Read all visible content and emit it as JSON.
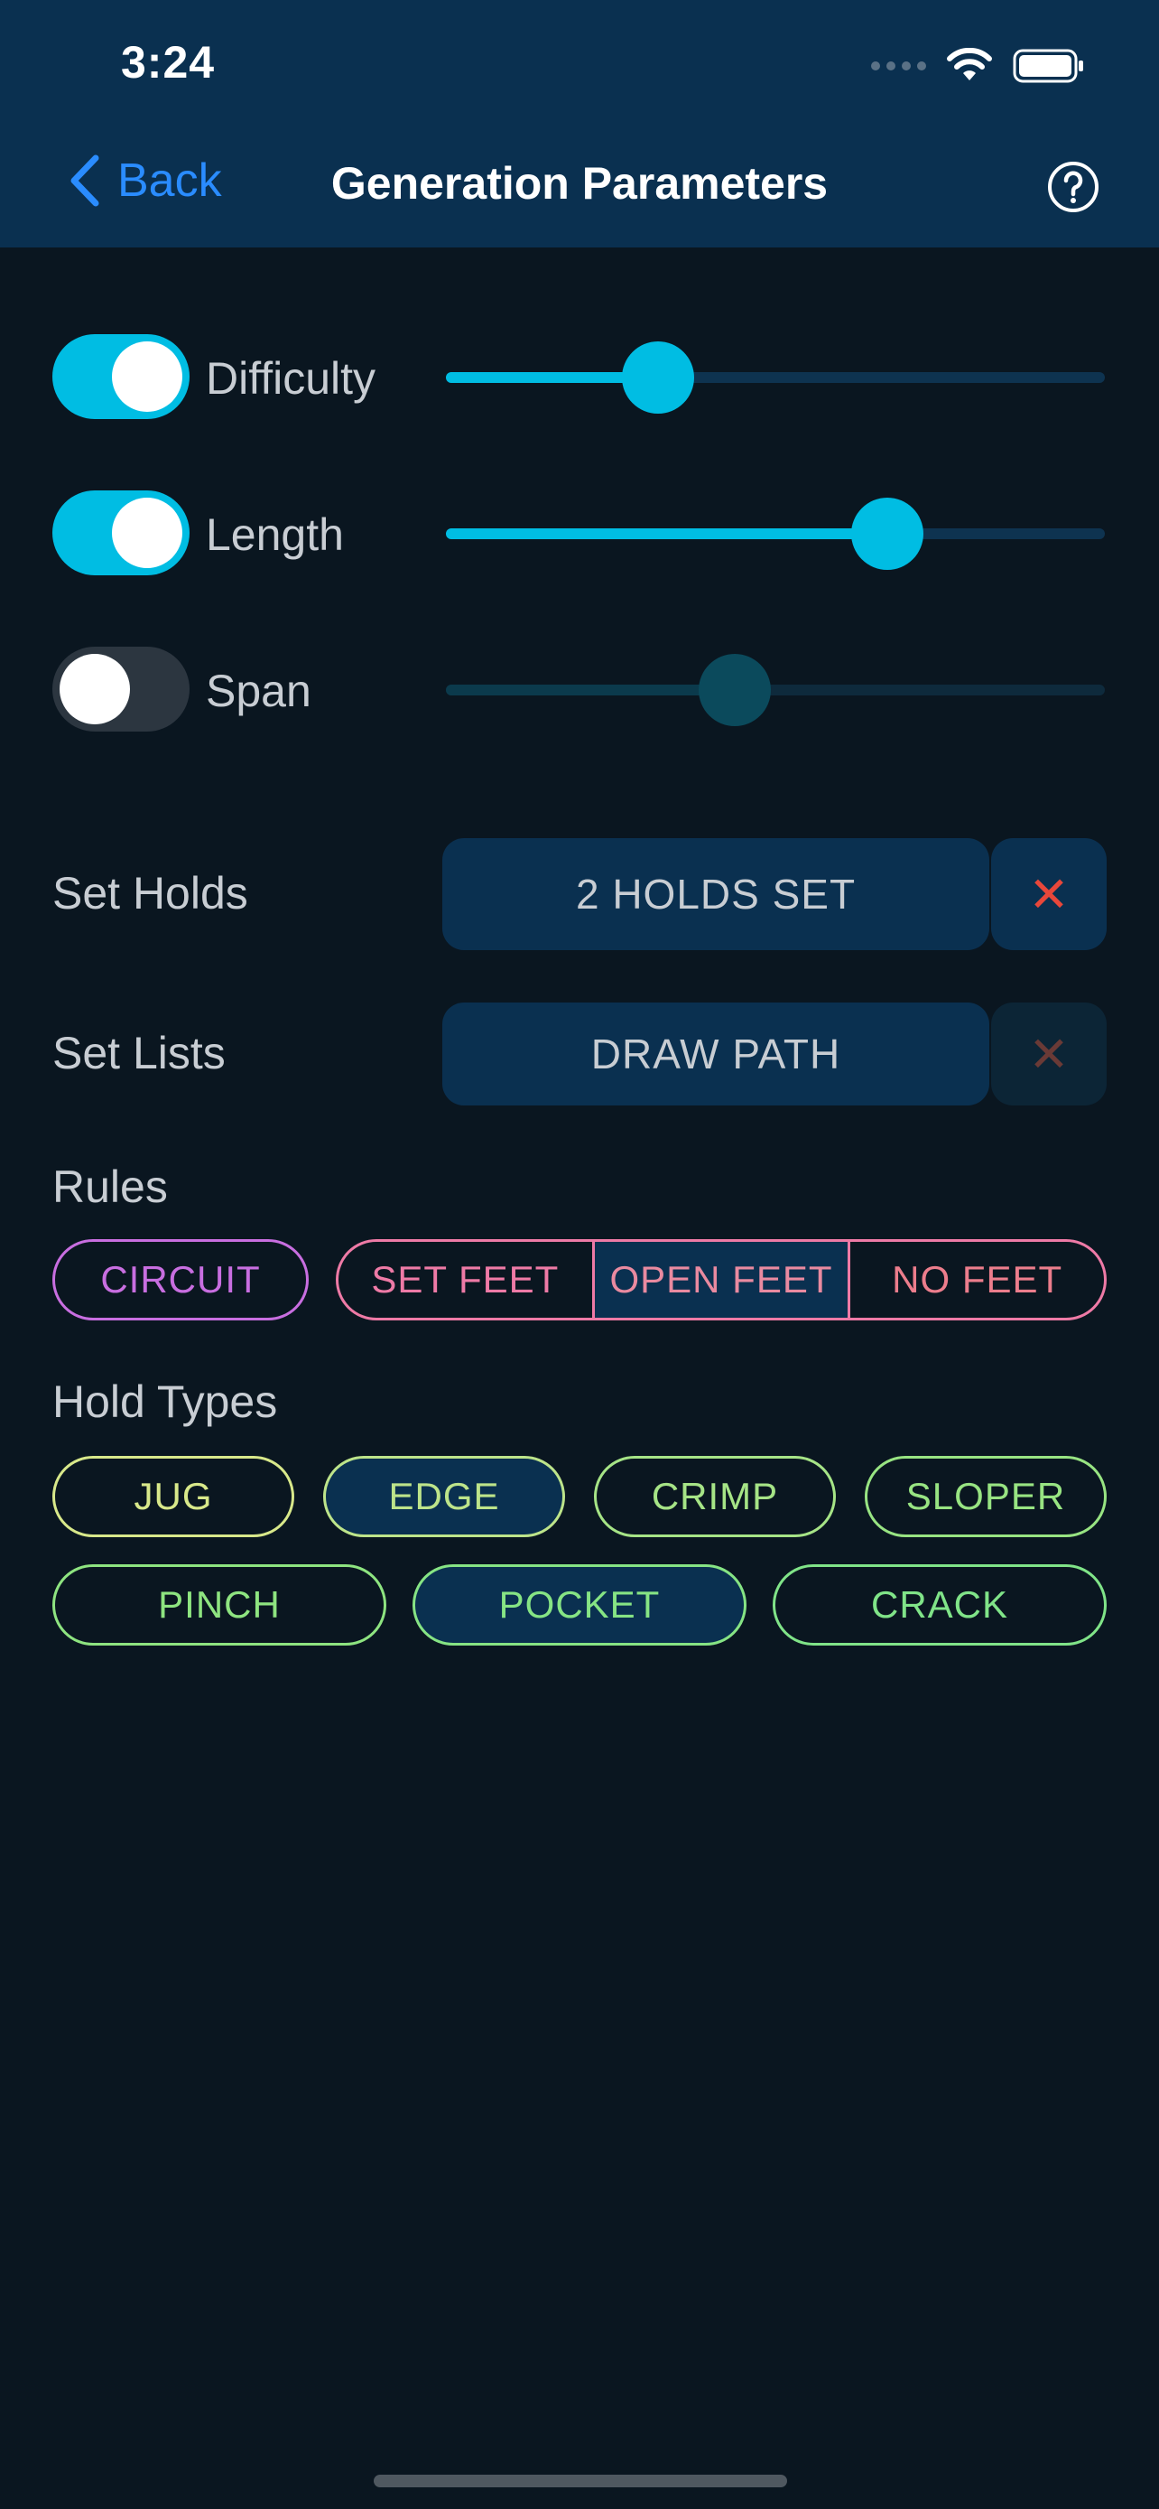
{
  "status_bar": {
    "time": "3:24"
  },
  "nav": {
    "back_label": "Back",
    "title": "Generation Parameters"
  },
  "parameters": [
    {
      "label": "Difficulty",
      "enabled": true,
      "value": 0.3
    },
    {
      "label": "Length",
      "enabled": true,
      "value": 0.69
    },
    {
      "label": "Span",
      "enabled": false,
      "value": 0.43
    }
  ],
  "set_holds": {
    "label": "Set Holds",
    "button": "2 HOLDS SET",
    "clear": "✕"
  },
  "set_lists": {
    "label": "Set Lists",
    "button": "DRAW PATH",
    "clear": "✕"
  },
  "rules": {
    "label": "Rules",
    "circuit": "CIRCUIT",
    "feet_options": [
      "SET FEET",
      "OPEN FEET",
      "NO FEET"
    ],
    "feet_selected": "OPEN FEET"
  },
  "hold_types": {
    "label": "Hold Types",
    "items": [
      "JUG",
      "EDGE",
      "CRIMP",
      "SLOPER",
      "PINCH",
      "POCKET",
      "CRACK"
    ],
    "selected": [
      "EDGE",
      "POCKET"
    ]
  },
  "colors": {
    "header_bg": "#0a3050",
    "page_bg": "#0a1620",
    "accent": "#00bde3",
    "back_blue": "#2a8cff",
    "clear_red": "#e8473a",
    "circuit": "#c86ee0",
    "feet": "#ee7aa6",
    "jug": "#d8e88a",
    "edge": "#bde48a",
    "crimp": "#a6e486",
    "sloper": "#98e482",
    "pinch": "#8ee480",
    "pocket": "#86e484",
    "crack": "#80e488"
  }
}
